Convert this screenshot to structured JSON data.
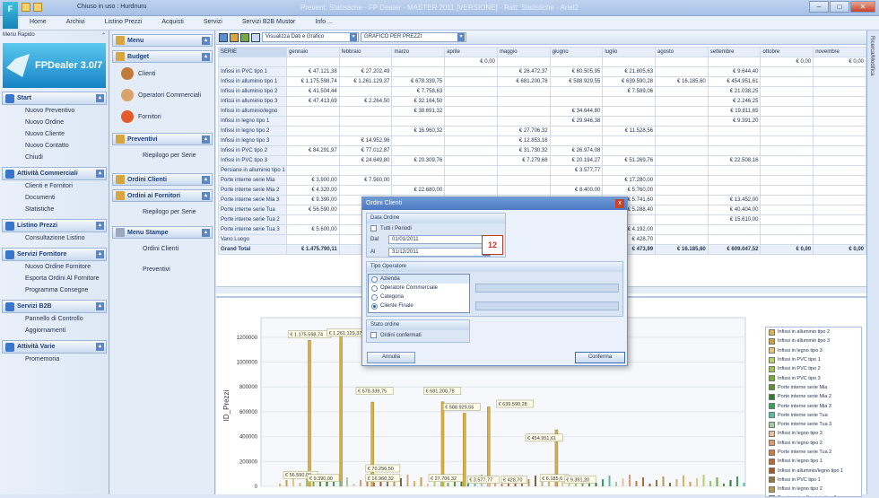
{
  "window": {
    "title": "Prevent: Statistiche - FP Dealer - MASTER 2011 [VERSIONE] - Ratt: Statistiche - Ariel2",
    "user": "Chiuso in uso : Hurdnuru",
    "minimize": "–",
    "maximize": "□",
    "close": "✕",
    "logo": "F"
  },
  "menu": [
    "Home",
    "Archivi",
    "Listino Prezzi",
    "Acquisti",
    "Servizi",
    "Servizi B2B Mustor",
    "Info ..."
  ],
  "sidebar": {
    "header": "Menu Rapido",
    "pin": "⌃",
    "brand": "FPDealer 3.0/7",
    "sections": [
      {
        "title": "Start",
        "items": [
          "Nuovo Preventivo",
          "Nuovo Ordine",
          "Nuovo Cliente",
          "Nuovo Contatto",
          "Chiudi"
        ]
      },
      {
        "title": "Attività Commerciali",
        "items": [
          "Clienti e Fornitori",
          "Documenti",
          "Statistiche"
        ]
      },
      {
        "title": "Listino Prezzi",
        "items": [
          "Consultazione Listino"
        ]
      },
      {
        "title": "Servizi Fornitore",
        "items": [
          "Nuovo Ordine Fornitore",
          "Esporta Ordini Al Fornitore",
          "Programma Consegne"
        ]
      },
      {
        "title": "Servizi B2B",
        "items": [
          "Pannello di Controllo",
          "Aggiornamenti"
        ]
      },
      {
        "title": "Attività Varie",
        "items": [
          "Promemoria"
        ]
      }
    ]
  },
  "col2": {
    "menu": "Menu",
    "budget": "Budget",
    "budget_items": [
      "Clienti",
      "Operatori Commerciali",
      "Fornitori"
    ],
    "preventivi": "Preventivi",
    "prev_sub": "Riepilogo per Serie",
    "ordini_clienti": "Ordini Clienti",
    "ordini_fornitori": "Ordini ai Fornitori",
    "of_sub": "Riepilogo per Serie",
    "stampe": "Menu Stampe",
    "stampe_items": [
      "Ordini Clienti",
      "Preventivi"
    ]
  },
  "toolbar": {
    "view": "Visualizza Dati e Grafico",
    "chart": "GRAFICO PER PREZZI"
  },
  "grid": {
    "header_label": "SERIE",
    "months": [
      "gennaio",
      "febbraio",
      "marzo",
      "aprile",
      "maggio",
      "giugno",
      "luglio",
      "agosto",
      "settembre",
      "ottobre",
      "novembre"
    ],
    "first_row": [
      "",
      "",
      "",
      "€ 0,00",
      "",
      "",
      "",
      "",
      "",
      "€ 0,00",
      "€ 0,00"
    ],
    "rows": [
      {
        "label": "Infissi in PVC tipo 1",
        "v": [
          "€ 47.121,38",
          "€ 27.202,49",
          "",
          "",
          "€ 26.472,37",
          "€ 60.505,95",
          "€ 21.805,63",
          "",
          "€ 9.644,40",
          "",
          ""
        ]
      },
      {
        "label": "Infissi in alluminio tipo 1",
        "v": [
          "€ 1.175.598,74",
          "€ 1.261.129,37",
          "€ 678.339,75",
          "",
          "€ 681.200,78",
          "€ 588.929,55",
          "€ 639.590,28",
          "€ 16.185,60",
          "€ 454.951,61",
          "",
          ""
        ]
      },
      {
        "label": "Infissi in alluminio tipo 2",
        "v": [
          "€ 41.504,44",
          "",
          "€ 7.758,63",
          "",
          "",
          "",
          "€ 7.589,06",
          "",
          "€ 21.038,25",
          "",
          ""
        ]
      },
      {
        "label": "Infissi in alluminio tipo 3",
        "v": [
          "€ 47.413,69",
          "€ 2.264,50",
          "€ 32.164,50",
          "",
          "",
          "",
          "",
          "",
          "€ 2.246,25",
          "",
          ""
        ]
      },
      {
        "label": "Infissi in alluminio/legno",
        "v": [
          "",
          "",
          "€ 38.691,32",
          "",
          "",
          "€ 34.644,80",
          "",
          "",
          "€ 19.811,65",
          "",
          ""
        ]
      },
      {
        "label": "Infissi in legno tipo 1",
        "v": [
          "",
          "",
          "",
          "",
          "",
          "€ 29.946,38",
          "",
          "",
          "€ 9.391,20",
          "",
          ""
        ]
      },
      {
        "label": "Infissi in legno tipo 2",
        "v": [
          "",
          "",
          "€ 16.960,32",
          "",
          "€ 27.706,32",
          "",
          "€ 11.528,56",
          "",
          "",
          "",
          ""
        ]
      },
      {
        "label": "Infissi in legno tipo 3",
        "v": [
          "",
          "€ 14.952,96",
          "",
          "",
          "€ 12.853,16",
          "",
          "",
          "",
          "",
          "",
          ""
        ]
      },
      {
        "label": "Infissi in PVC tipo 2",
        "v": [
          "€ 84.291,97",
          "€ 77.012,87",
          "",
          "",
          "€ 31.730,32",
          "€ 26.974,08",
          "",
          "",
          "",
          "",
          ""
        ]
      },
      {
        "label": "Infissi in PVC tipo 3",
        "v": [
          "",
          "€ 24.649,80",
          "€ 20.309,76",
          "",
          "€ 7.279,68",
          "€ 20.194,27",
          "€ 51.269,76",
          "",
          "€ 22.508,16",
          "",
          ""
        ]
      },
      {
        "label": "Persiane in alluminio tipo 1",
        "v": [
          "",
          "",
          "",
          "",
          "",
          "€ 3.577,77",
          "",
          "",
          "",
          "",
          ""
        ]
      },
      {
        "label": "Porte interne serie Mia",
        "v": [
          "€ 3.900,00",
          "€ 7.560,00",
          "",
          "",
          "",
          "",
          "€ 17.280,00",
          "",
          "",
          "",
          ""
        ]
      },
      {
        "label": "Porte interne serie Mia 2",
        "v": [
          "€ 4.320,00",
          "",
          "€ 22.680,00",
          "",
          "",
          "€ 8.400,00",
          "€ 5.760,00",
          "",
          "",
          "",
          ""
        ]
      },
      {
        "label": "Porte interne serie Mia 3",
        "v": [
          "€ 9.390,00",
          "€ 9.795,00",
          "",
          "",
          "",
          "",
          "€ 5.741,60",
          "",
          "€ 13.452,00",
          "",
          ""
        ]
      },
      {
        "label": "Porte interne serie Tua",
        "v": [
          "€ 56.590,00",
          "€ 24.210,00",
          "",
          "",
          "",
          "",
          "€ 5.288,40",
          "",
          "€ 40.404,00",
          "",
          ""
        ]
      },
      {
        "label": "Porte interne serie Tua 2",
        "v": [
          "",
          "",
          "",
          "",
          "",
          "",
          "",
          "",
          "€ 15.610,00",
          "",
          ""
        ]
      },
      {
        "label": "Porte interne serie Tua 3",
        "v": [
          "€ 5.600,00",
          "",
          "",
          "",
          "",
          "",
          "€ 4.192,00",
          "",
          "",
          "",
          ""
        ]
      },
      {
        "label": "Vano Luogo",
        "v": [
          "",
          "",
          "",
          "",
          "",
          "",
          "€ 428,70",
          "",
          "",
          "",
          ""
        ]
      }
    ],
    "total": {
      "label": "Grand Total",
      "v": [
        "€ 1.475.790,11",
        "€ 1.4",
        "",
        "",
        "",
        "",
        "€ 473,99",
        "€ 16.185,60",
        "€ 609.047,52",
        "€ 0,00",
        "€ 0,00"
      ]
    }
  },
  "dialog": {
    "title": "Ordini Clienti",
    "close": "x",
    "date_group": "Data Ordine",
    "all_periods": "Tutti i Periodi",
    "from_label": "Dal",
    "from": "01/01/2011",
    "to_label": "Al",
    "to": "31/12/2011",
    "cal_day": "12",
    "op_group": "Tipo Operatore",
    "options": [
      "Azienda",
      "Operatore Commerciale",
      "Categoria",
      "Cliente Finale"
    ],
    "status_group": "Stato ordine",
    "confirmed": "Ordini confermati",
    "cancel": "Annulla",
    "confirm": "Conferma"
  },
  "chart_data": {
    "type": "bar",
    "ylabel": "ID_Prezzi",
    "ylim": [
      0,
      1300000
    ],
    "yticks": [
      "0",
      "200000",
      "400000",
      "600000",
      "800000",
      "1000000",
      "1200000"
    ],
    "annotations": [
      "€ 1.175.598,74",
      "€ 1.261.129,37",
      "€ 678.339,75",
      "€ 681.200,78",
      "€ 588.929,55",
      "€ 639.590,28",
      "€ 454.951,61",
      "€ 56.590,00",
      "€ 70.256,50",
      "€ 16.960,32",
      "€ 27.706,32",
      "€ 3.577,77",
      "€ 428,70",
      "€ 6.185,6",
      "€ 9.391,20",
      "€ 9.390,00"
    ],
    "peaks": [
      {
        "pos": 0.1,
        "value": 1175598.74
      },
      {
        "pos": 0.165,
        "value": 1261129.37
      },
      {
        "pos": 0.23,
        "value": 678339.75
      },
      {
        "pos": 0.375,
        "value": 681200.78
      },
      {
        "pos": 0.42,
        "value": 588929.55
      },
      {
        "pos": 0.47,
        "value": 639590.28
      },
      {
        "pos": 0.61,
        "value": 454951.61
      }
    ],
    "legend": [
      {
        "name": "Infissi in alluminio tipo 2",
        "color": "#d9b45c"
      },
      {
        "name": "Infissi in alluminio tipo 3",
        "color": "#c8a04a"
      },
      {
        "name": "Infissi in legno tipo 3",
        "color": "#e1c682"
      },
      {
        "name": "Infissi in PVC tipo 1",
        "color": "#b7d06a"
      },
      {
        "name": "Infissi in PVC tipo 2",
        "color": "#9cc45a"
      },
      {
        "name": "Infissi in PVC tipo 3",
        "color": "#7aa843"
      },
      {
        "name": "Porte interne serie Mia",
        "color": "#5a8e3a"
      },
      {
        "name": "Porte interne serie Mia 2",
        "color": "#2e7a32"
      },
      {
        "name": "Porte interne serie Mia 3",
        "color": "#3aa05a"
      },
      {
        "name": "Porte interne serie Tua",
        "color": "#5fb8a0"
      },
      {
        "name": "Porte interne serie Tua 3",
        "color": "#a3c9a0"
      },
      {
        "name": "Infissi in legno tipo 3",
        "color": "#e8c0a0"
      },
      {
        "name": "Infissi in legno tipo 2",
        "color": "#d89a70"
      },
      {
        "name": "Porte interne serie Tua 2",
        "color": "#c77a4a"
      },
      {
        "name": "Infissi in legno tipo 1",
        "color": "#b56a3a"
      },
      {
        "name": "Infissi in alluminio/legno tipo 1",
        "color": "#9c5a2a"
      },
      {
        "name": "Infissi in PVC tipo 1",
        "color": "#8c7a40"
      },
      {
        "name": "Infissi in legno tipo 2",
        "color": "#b49c58"
      },
      {
        "name": "Persiane in alluminio tipo 1",
        "color": "#6e6a3a"
      },
      {
        "name": "Vano Luogo",
        "color": "#c2b07a"
      }
    ]
  },
  "rightbar": "Ricerca/Modifica"
}
